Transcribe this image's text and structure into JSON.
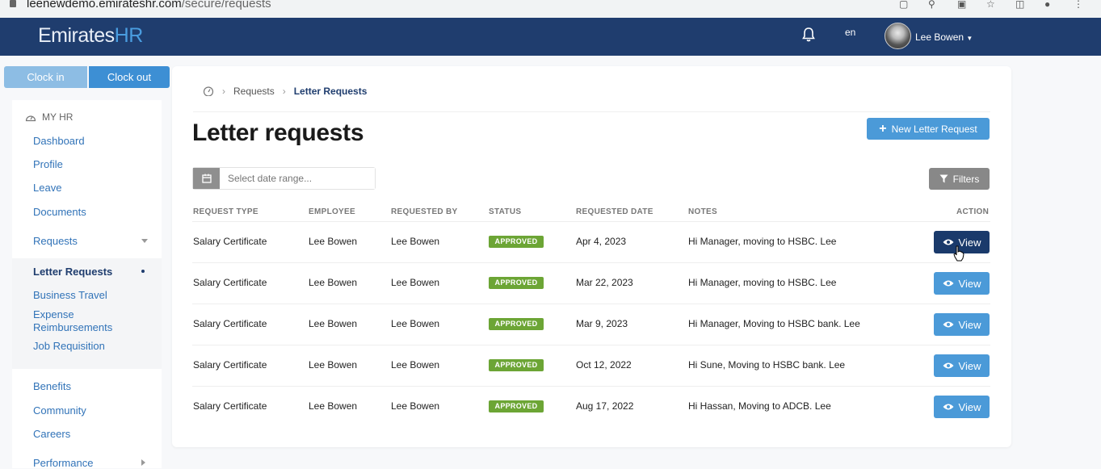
{
  "browser": {
    "url_host": "leenewdemo.emirateshr.com",
    "url_path": "/secure/requests"
  },
  "header": {
    "logo_main": "Emirates",
    "logo_accent": "HR",
    "language": "en",
    "user_name": "Lee Bowen"
  },
  "clock": {
    "clock_in": "Clock in",
    "clock_out": "Clock out"
  },
  "sidebar": {
    "section": "MY HR",
    "items": {
      "dashboard": "Dashboard",
      "profile": "Profile",
      "leave": "Leave",
      "documents": "Documents",
      "requests": "Requests",
      "letter_requests": "Letter Requests",
      "business_travel": "Business Travel",
      "expense_1": "Expense",
      "expense_2": "Reimbursements",
      "job_requisition": "Job Requisition",
      "benefits": "Benefits",
      "community": "Community",
      "careers": "Careers",
      "performance": "Performance"
    }
  },
  "breadcrumb": {
    "parent": "Requests",
    "current": "Letter Requests"
  },
  "page": {
    "title": "Letter requests",
    "new_button": "New Letter Request",
    "date_placeholder": "Select date range...",
    "filters_button": "Filters"
  },
  "table": {
    "headers": [
      "REQUEST TYPE",
      "EMPLOYEE",
      "REQUESTED BY",
      "STATUS",
      "REQUESTED DATE",
      "NOTES",
      "ACTION"
    ],
    "rows": [
      {
        "type": "Salary Certificate",
        "employee": "Lee Bowen",
        "requested_by": "Lee Bowen",
        "status": "APPROVED",
        "date": "Apr 4, 2023",
        "notes": "Hi Manager, moving to HSBC. Lee",
        "action": "View"
      },
      {
        "type": "Salary Certificate",
        "employee": "Lee Bowen",
        "requested_by": "Lee Bowen",
        "status": "APPROVED",
        "date": "Mar 22, 2023",
        "notes": "Hi Manager, moving to HSBC. Lee",
        "action": "View"
      },
      {
        "type": "Salary Certificate",
        "employee": "Lee Bowen",
        "requested_by": "Lee Bowen",
        "status": "APPROVED",
        "date": "Mar 9, 2023",
        "notes": "Hi Manager, Moving to HSBC bank. Lee",
        "action": "View"
      },
      {
        "type": "Salary Certificate",
        "employee": "Lee Bowen",
        "requested_by": "Lee Bowen",
        "status": "APPROVED",
        "date": "Oct 12, 2022",
        "notes": "Hi Sune, Moving to HSBC bank. Lee",
        "action": "View"
      },
      {
        "type": "Salary Certificate",
        "employee": "Lee Bowen",
        "requested_by": "Lee Bowen",
        "status": "APPROVED",
        "date": "Aug 17, 2022",
        "notes": "Hi Hassan, Moving to ADCB. Lee",
        "action": "View"
      }
    ]
  },
  "colors": {
    "nav": "#1f3d6e",
    "accent": "#4b9ad8",
    "approved": "#6ca535",
    "view_hover": "#1a3a6b"
  }
}
